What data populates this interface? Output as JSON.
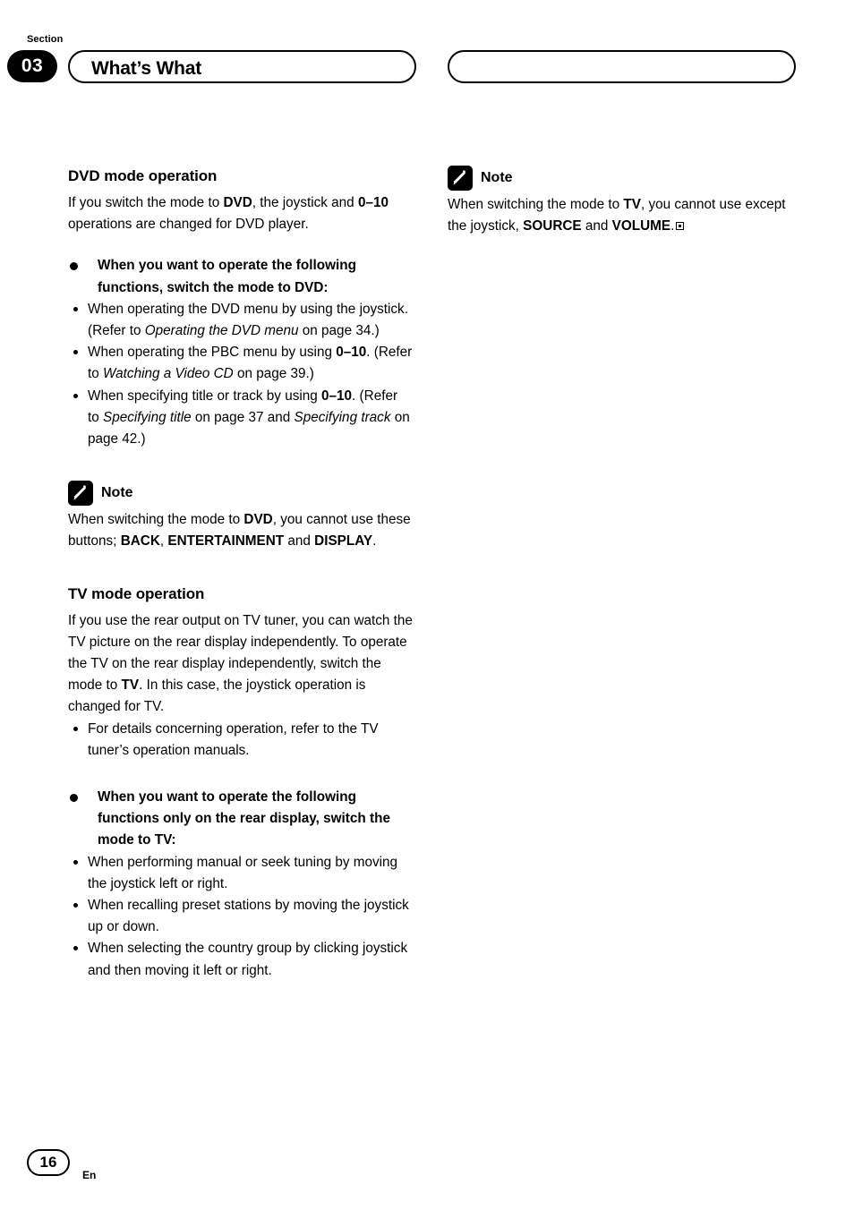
{
  "header": {
    "section_label": "Section",
    "section_number": "03",
    "title": "What’s What"
  },
  "footer": {
    "page_number": "16",
    "language": "En"
  },
  "left_column": {
    "dvd_heading_a": "DVD",
    "dvd_heading_b": " mode operation",
    "dvd_intro_1": "If you switch the mode to ",
    "dvd_intro_b1": "DVD",
    "dvd_intro_2": ", the joystick and ",
    "dvd_intro_b2": "0–10",
    "dvd_intro_3": " operations are changed for DVD player.",
    "dvd_bullet_head": "When you want to operate the following functions, switch the mode to DVD:",
    "dvd_items": [
      {
        "t1": "When operating the DVD menu by using the joystick. (Refer to ",
        "i1": "Operating the DVD menu",
        "t2": " on page 34.)"
      },
      {
        "t1": "When operating the PBC menu by using ",
        "b1": "0–10",
        "t2": ". (Refer to ",
        "i1": "Watching a Video CD",
        "t3": " on page 39.)"
      },
      {
        "t1": "When specifying title or track by using ",
        "b1": "0–10",
        "t2": ". (Refer to ",
        "i1": "Specifying title",
        "t3": " on page 37 and ",
        "i2": "Specifying track",
        "t4": " on page 42.)"
      }
    ],
    "note_label": "Note",
    "note_1": "When switching the mode to ",
    "note_b1": "DVD",
    "note_2": ", you cannot use these buttons; ",
    "note_b2": "BACK",
    "note_3": ", ",
    "note_b3": "ENTERTAINMENT",
    "note_4": " and ",
    "note_b4": "DISPLAY",
    "note_5": ".",
    "tv_heading_a": "TV",
    "tv_heading_b": " mode operation",
    "tv_intro_1": "If you use the rear output on TV tuner, you can watch the TV picture on the rear display independently. To operate the TV on the rear display independently, switch the mode to ",
    "tv_intro_b1": "TV",
    "tv_intro_2": ". In this case, the joystick operation is changed for TV.",
    "tv_item_1": "For details concerning operation, refer to the TV tuner’s operation manuals.",
    "tv_bullet_head": "When you want to operate the following functions only on the rear display, switch the mode to TV:",
    "tv_items": [
      "When performing manual or seek tuning by moving the joystick left or right.",
      "When recalling preset stations by moving the joystick up or down.",
      "When selecting the country group by clicking joystick and then moving it left or right."
    ]
  },
  "right_column": {
    "note_label": "Note",
    "note_1": "When switching the mode to ",
    "note_b1": "TV",
    "note_2": ", you cannot use except the joystick, ",
    "note_b2": "SOURCE",
    "note_3": " and ",
    "note_b3": "VOLUME",
    "note_4": "."
  },
  "icons": {
    "note_icon": "pencil-note-icon",
    "end_marker": "filled-square-icon"
  }
}
